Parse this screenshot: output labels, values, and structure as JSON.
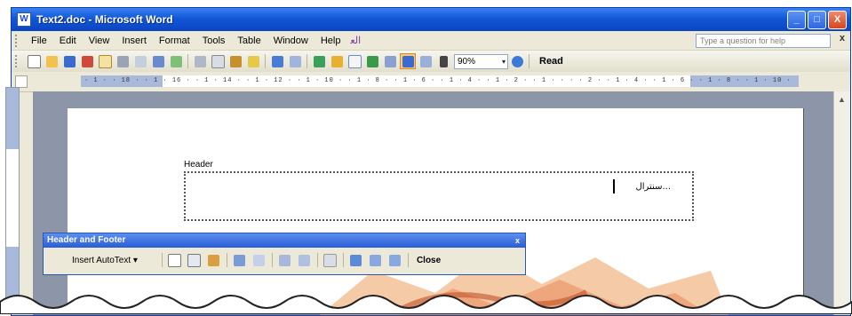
{
  "window": {
    "title": "Text2.doc - Microsoft Word",
    "controls": [
      "_",
      "□",
      "X"
    ]
  },
  "menubar": {
    "items": [
      "File",
      "Edit",
      "View",
      "Insert",
      "Format",
      "Tools",
      "Table",
      "Window",
      "Help"
    ],
    "extra": "ﺍﻟﻌ",
    "ask_placeholder": "Type a question for help",
    "close": "x"
  },
  "toolbar": {
    "zoom": "90%",
    "read_label": "Read"
  },
  "document": {
    "header_label": "Header",
    "header_text": "...سنترال"
  },
  "hf_toolbar": {
    "title": "Header and Footer",
    "close_x": "x",
    "insert_autotext": "Insert AutoText ▾",
    "close_label": "Close"
  },
  "ruler": {
    "text": "· 1 · · 18 · · 1 · 16 · · 1 · 14 · · 1 · 12 · · 1 · 10 · · 1 · 8 · · 1 · 6 · · 1 · 4 · · 1 · 2 · · 1 · · · · 2 · · 1 · 4 · · 1 · 6 · · 1 · 8 · · 1 · 10 · · 1 · 12 · ·"
  }
}
